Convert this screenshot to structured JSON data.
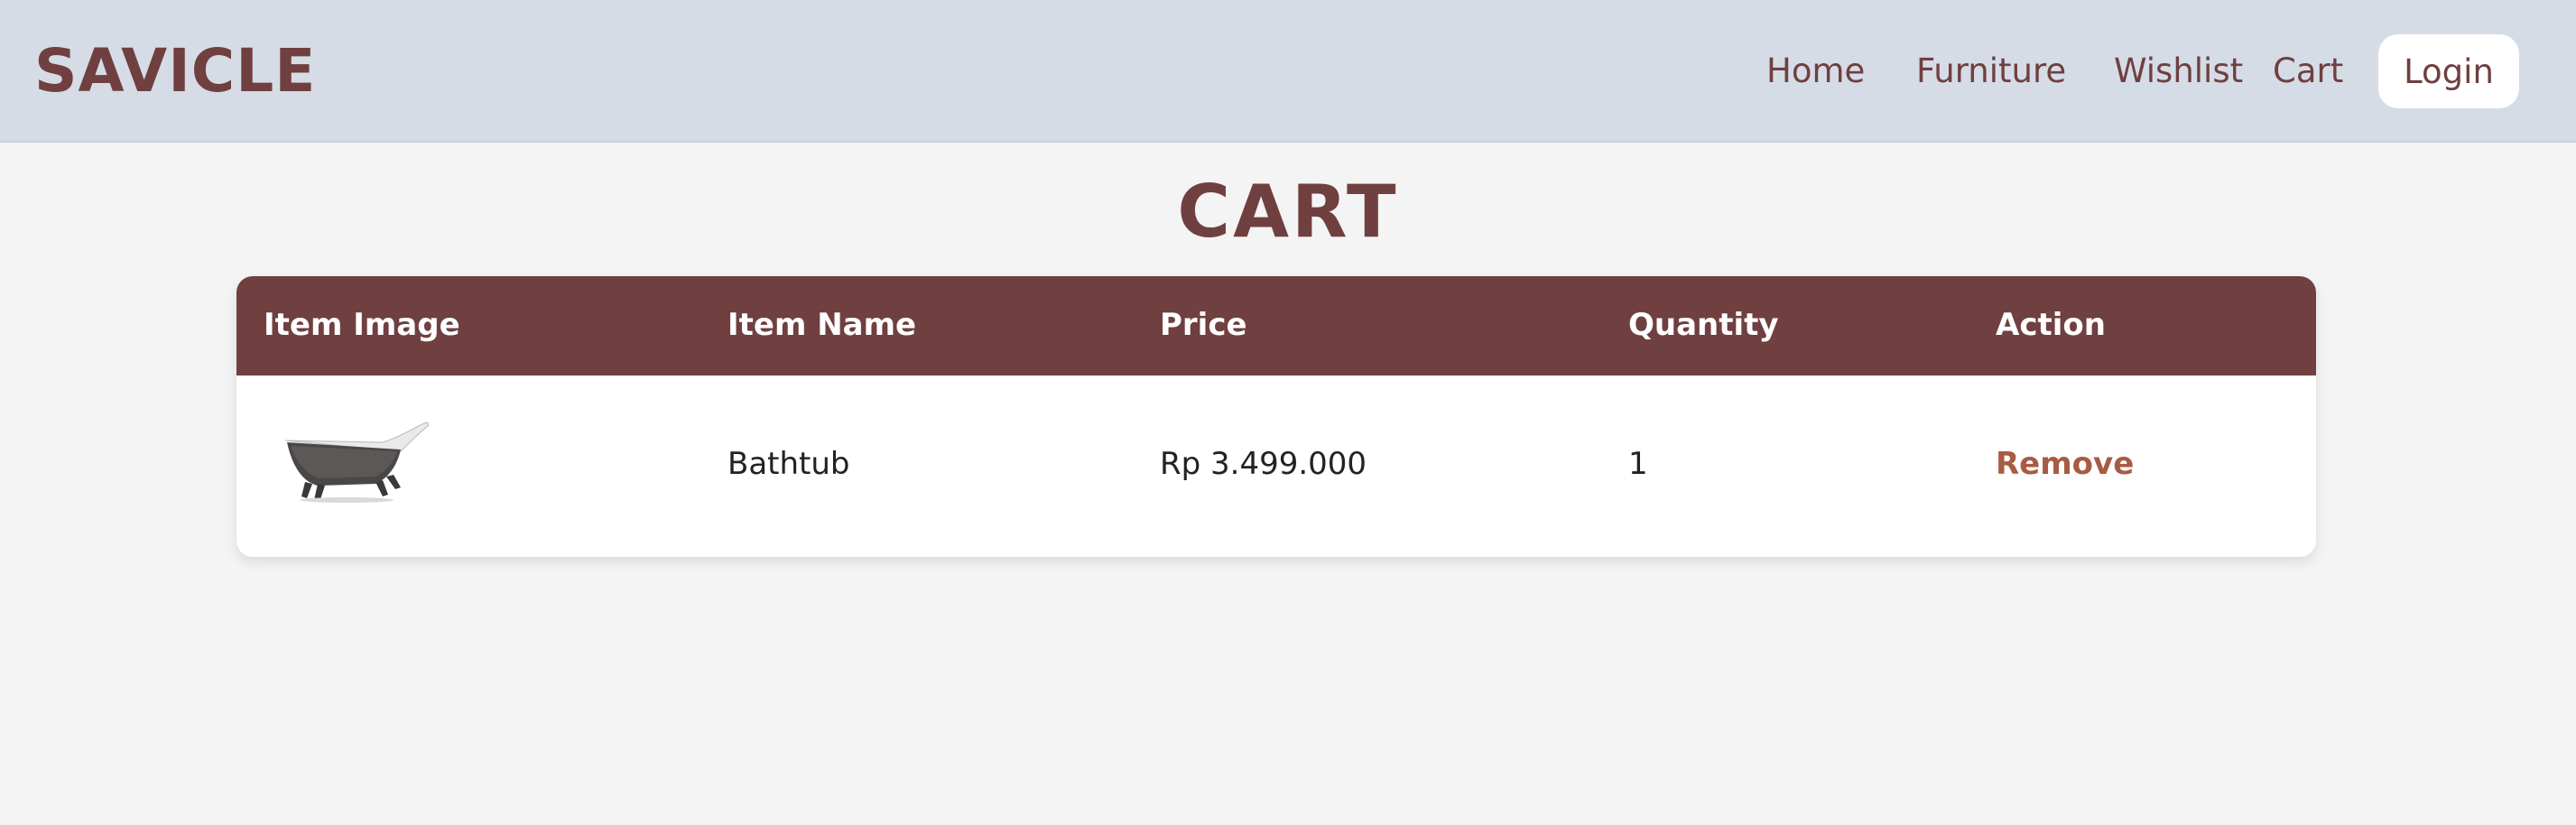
{
  "header": {
    "brand": "SAVICLE",
    "nav": [
      "Home",
      "Furniture",
      "Wishlist",
      "Cart"
    ],
    "login_label": "Login"
  },
  "page": {
    "title": "CART"
  },
  "table": {
    "columns": [
      "Item Image",
      "Item Name",
      "Price",
      "Quantity",
      "Action"
    ],
    "rows": [
      {
        "image_alt": "bathtub-image",
        "name": "Bathtub",
        "price": "Rp 3.499.000",
        "quantity": "1",
        "action": "Remove"
      }
    ]
  },
  "colors": {
    "brand": "#703f40",
    "header_bg": "#d5dce6",
    "page_bg": "#f4f4f4",
    "action_link": "#a85b43"
  }
}
